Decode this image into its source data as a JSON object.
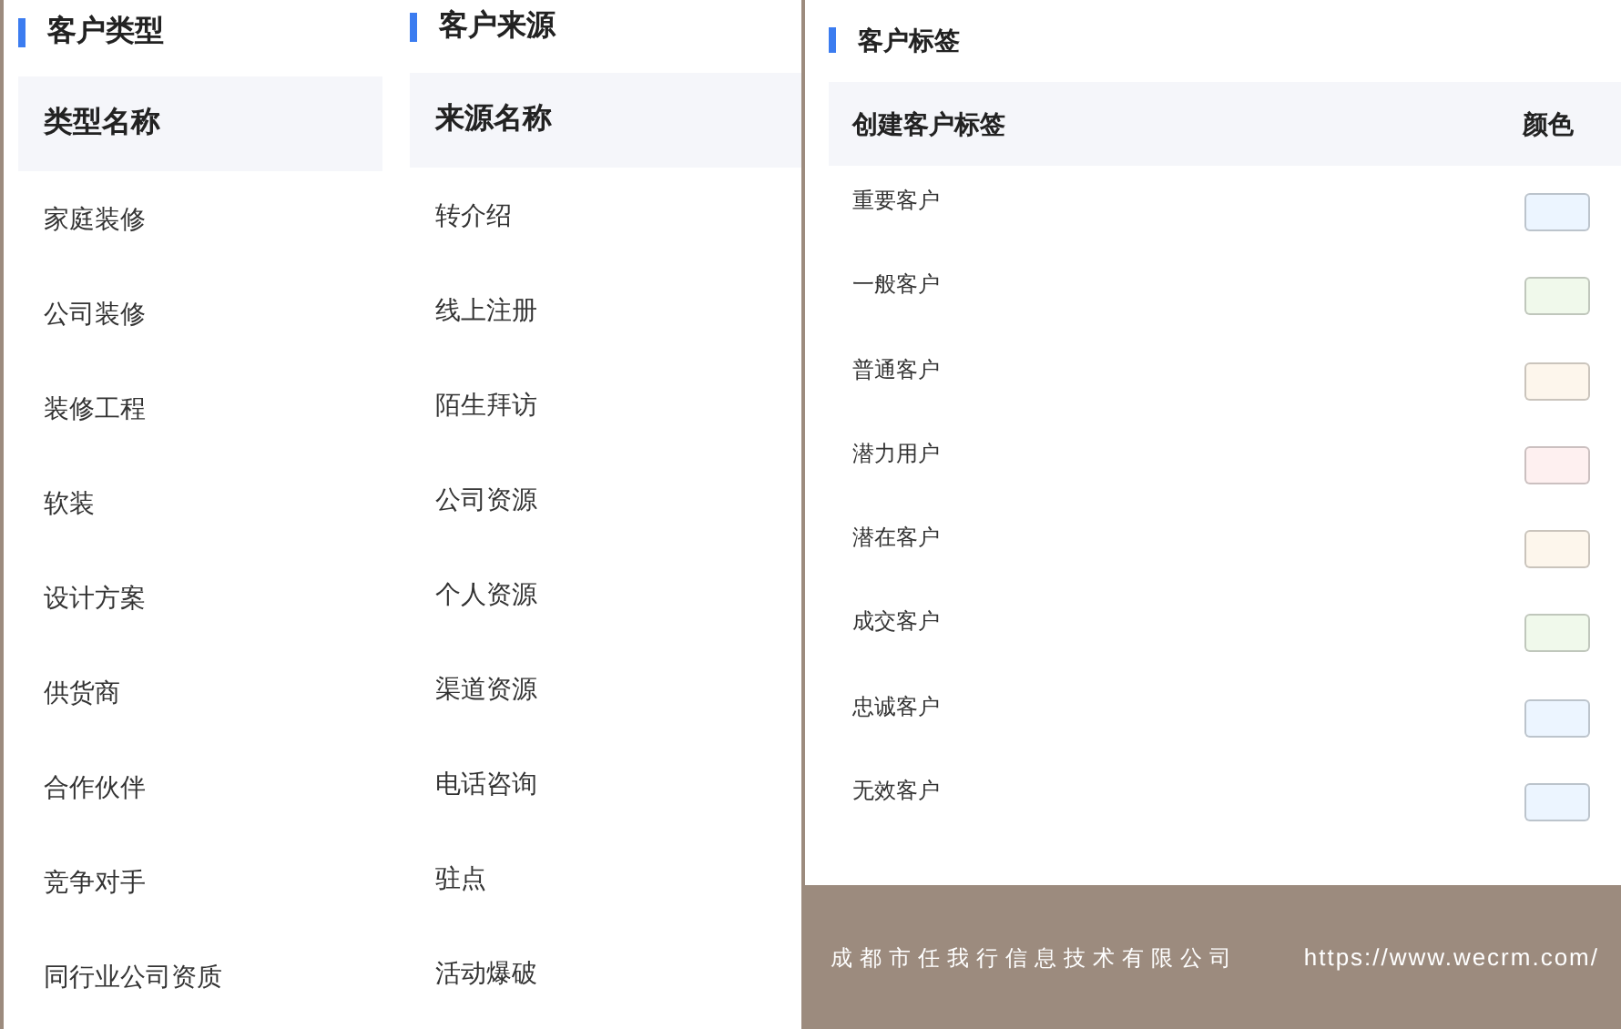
{
  "customer_types": {
    "title": "客户类型",
    "header": "类型名称",
    "rows": [
      "家庭装修",
      "公司装修",
      "装修工程",
      "软装",
      "设计方案",
      "供货商",
      "合作伙伴",
      "竞争对手",
      "同行业公司资质"
    ]
  },
  "customer_sources": {
    "title": "客户来源",
    "header": "来源名称",
    "rows": [
      "转介绍",
      "线上注册",
      "陌生拜访",
      "公司资源",
      "个人资源",
      "渠道资源",
      "电话咨询",
      "驻点",
      "活动爆破"
    ]
  },
  "customer_tags": {
    "title": "客户标签",
    "columns": [
      "创建客户标签",
      "颜色"
    ],
    "rows": [
      {
        "name": "重要客户",
        "color": "#ecf5ff"
      },
      {
        "name": "一般客户",
        "color": "#f0f9eb"
      },
      {
        "name": "普通客户",
        "color": "#fdf6ec"
      },
      {
        "name": "潜力用户",
        "color": "#fef0f0"
      },
      {
        "name": "潜在客户",
        "color": "#fdf6ec"
      },
      {
        "name": "成交客户",
        "color": "#f0f9eb"
      },
      {
        "name": "忠诚客户",
        "color": "#ecf5ff"
      },
      {
        "name": "无效客户",
        "color": "#ecf5ff"
      }
    ]
  },
  "footer": {
    "company": "成都市任我行信息技术有限公司",
    "url": "https://www.wecrm.com/"
  }
}
